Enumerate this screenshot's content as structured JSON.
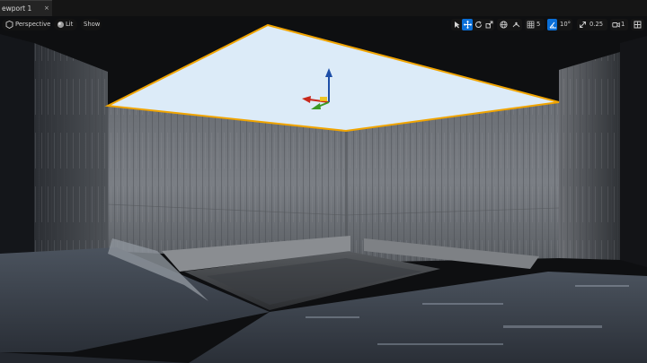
{
  "tab": {
    "title": "ewport 1",
    "close_glyph": "×"
  },
  "toolbar": {
    "view_mode": "Perspective",
    "lighting_mode": "Lit",
    "show_label": "Show",
    "grid_size": "5",
    "rotation_snap": "10°",
    "scale_snap": "0.25",
    "camera_speed": "1"
  },
  "colors": {
    "accent": "#0a6fd8",
    "selection_outline": "#f0a400",
    "skylight": "#dcebf8"
  },
  "icons": [
    "viewport-menu-icon",
    "lit-sphere-icon",
    "select-arrow-icon",
    "translate-icon",
    "rotate-icon",
    "scale-icon",
    "world-space-icon",
    "surface-snap-icon",
    "grid-snap-icon",
    "rotation-snap-icon",
    "scale-snap-icon",
    "camera-speed-icon",
    "maximize-icon"
  ]
}
